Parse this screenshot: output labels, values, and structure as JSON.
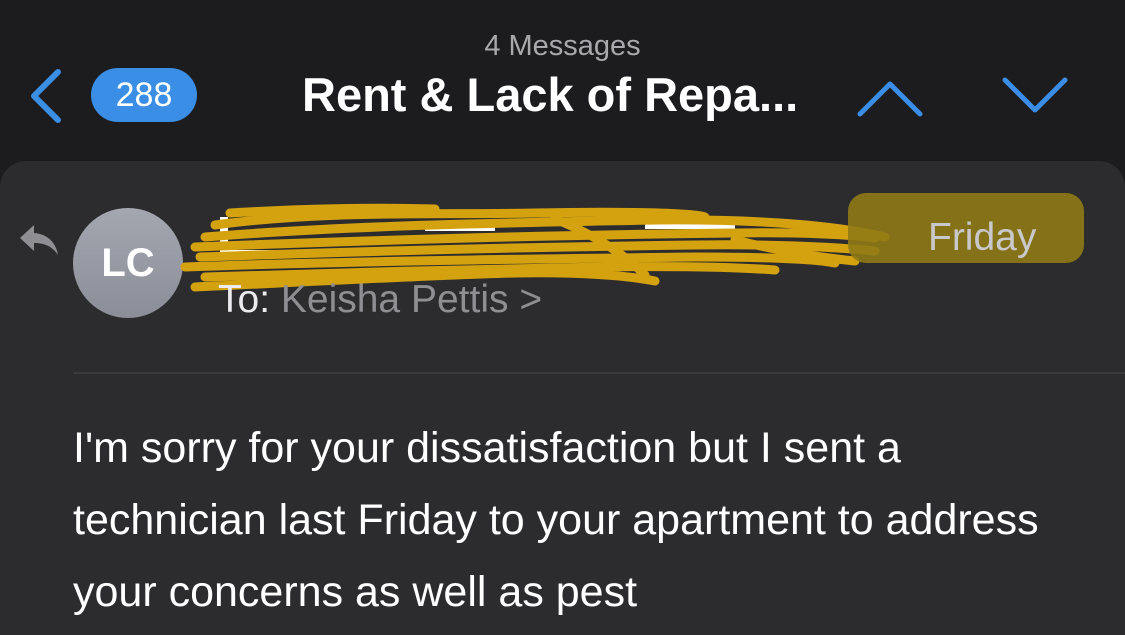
{
  "header": {
    "message_count": "4 Messages",
    "subject": "Rent & Lack of Repa...",
    "badge_count": "288"
  },
  "message": {
    "avatar_initials": "LC",
    "date": "Friday",
    "to_label": "To:",
    "recipient": "Keisha Pettis",
    "recipient_chevron": ">",
    "body": "I'm sorry for your dissatisfaction but I sent a technician last Friday to your apartment to address your concerns as well as pest"
  },
  "colors": {
    "accent": "#3a8ee6",
    "background": "#1c1c1e",
    "card": "#2c2c2e",
    "redaction": "#d4a20f"
  },
  "icons": {
    "back": "chevron-left-icon",
    "previous": "chevron-up-icon",
    "next": "chevron-down-icon",
    "reply": "reply-arrow-icon"
  }
}
